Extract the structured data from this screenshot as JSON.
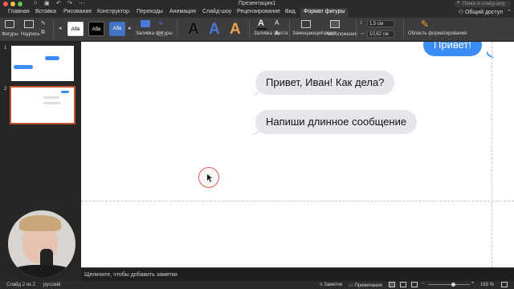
{
  "window": {
    "title": "Презентация1"
  },
  "search": {
    "placeholder": "Поиск в слайд-шоу"
  },
  "tabs": [
    {
      "label": "Главная"
    },
    {
      "label": "Вставка"
    },
    {
      "label": "Рисование"
    },
    {
      "label": "Конструктор"
    },
    {
      "label": "Переходы"
    },
    {
      "label": "Анимация"
    },
    {
      "label": "Слайд-шоу"
    },
    {
      "label": "Рецензирование"
    },
    {
      "label": "Вид"
    },
    {
      "label": "Формат фигуры"
    }
  ],
  "share": {
    "label": "Общий доступ"
  },
  "ribbon": {
    "shapes_label": "Фигуры",
    "textbox_label": "Надпись",
    "style1": "Абв",
    "style2": "Абв",
    "style3": "Абв",
    "shape_fill_label": "Заливка фигуры",
    "text_fill_label": "Заливка текста",
    "alt_text_label": "Замещающий текст",
    "arrange_label": "Расположение",
    "height_value": "1,5 см",
    "width_value": "10,62 см",
    "format_pane_label": "Область форматирования",
    "wordart_a": "A"
  },
  "slides": [
    {
      "number": "1",
      "thumb_bubble_text": "Привет!"
    },
    {
      "number": "2"
    }
  ],
  "slide": {
    "bubble_top_right": "Привет!",
    "bubble_1": "Привет, Иван! Как дела?",
    "bubble_2": "Напиши длинное сообщение"
  },
  "notes": {
    "placeholder": "Щелкните, чтобы добавить заметки"
  },
  "status": {
    "slide_info": "Слайд 2 из 2",
    "language": "русский",
    "notes_btn": "Заметки",
    "comments_btn": "Примечания",
    "zoom": "163 %"
  },
  "colors": {
    "accent": "#c0532e",
    "bubble_blue": "#3a8cf7",
    "bubble_gray": "#e5e5ea"
  }
}
